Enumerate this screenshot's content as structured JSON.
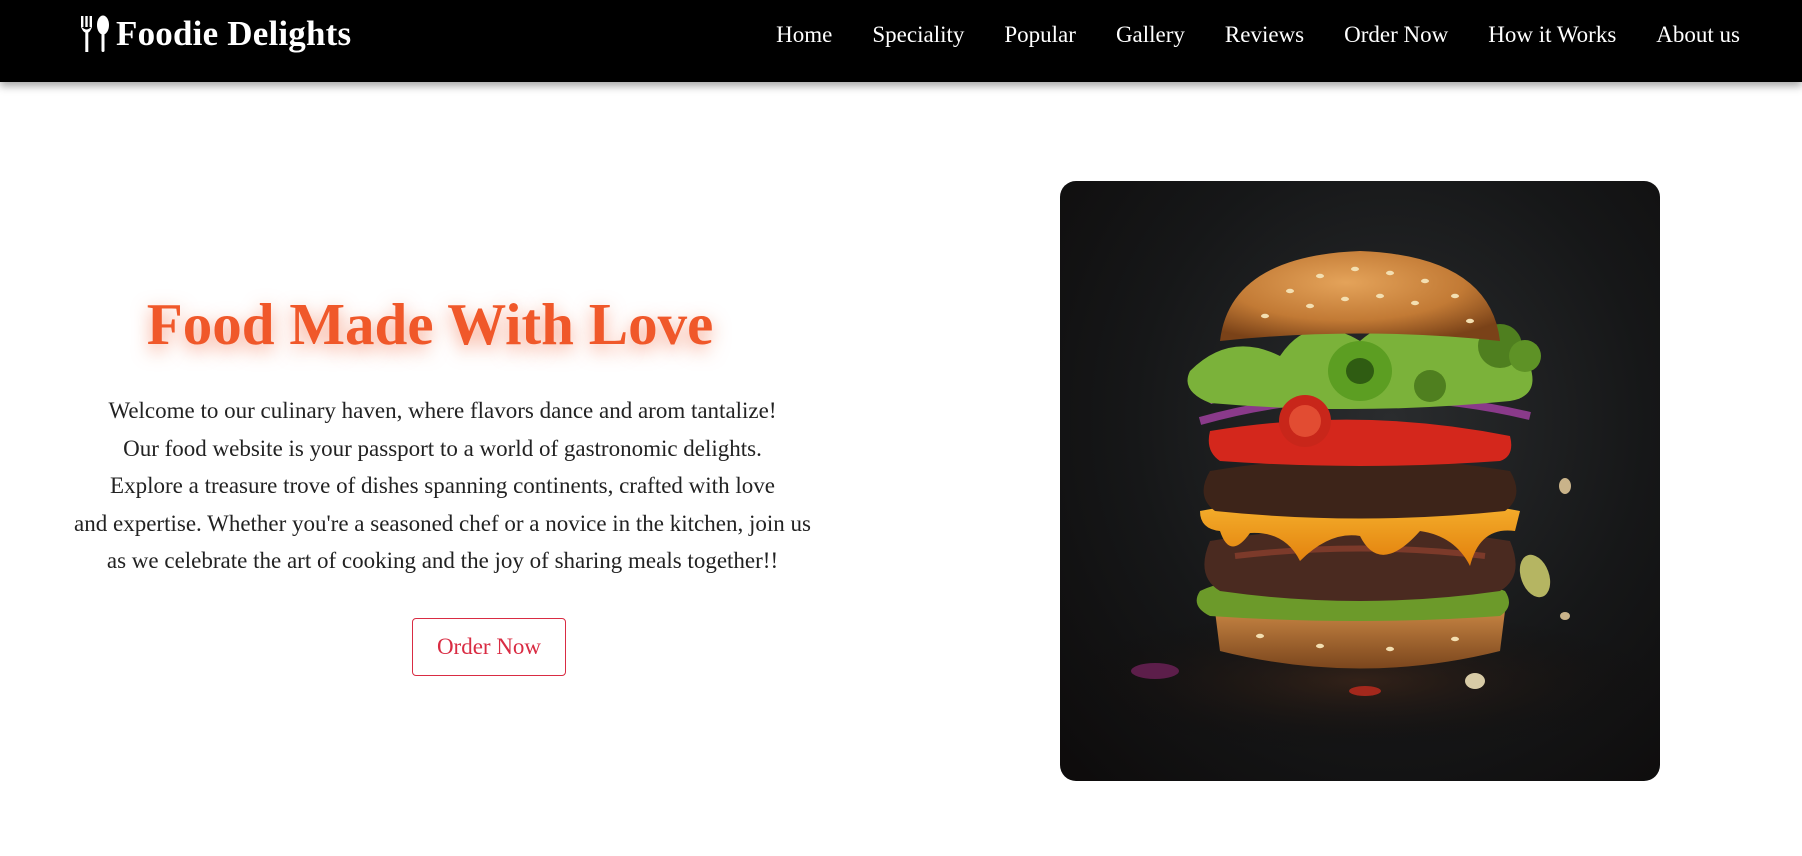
{
  "navbar": {
    "brand_icon": "fork-spoon-icon",
    "brand_name": "Foodie Delights",
    "links": [
      {
        "label": "Home"
      },
      {
        "label": "Speciality"
      },
      {
        "label": "Popular"
      },
      {
        "label": "Gallery"
      },
      {
        "label": "Reviews"
      },
      {
        "label": "Order Now"
      },
      {
        "label": "How it Works"
      },
      {
        "label": "About us"
      }
    ]
  },
  "hero": {
    "title": "Food Made With Love",
    "description_lines": [
      "Welcome to our culinary haven, where flavors dance and arom tantalize!",
      "Our food website is your passport to a world of gastronomic delights.",
      "Explore a treasure trove of dishes spanning continents, crafted with love",
      "and expertise. Whether you're a seasoned chef or a novice in the kitchen, join us",
      "as we celebrate the art of cooking and the joy of sharing meals together!!"
    ],
    "order_button_label": "Order Now",
    "image": "burger-image"
  },
  "colors": {
    "navbar_bg": "#000000",
    "title": "#f0582a",
    "button_accent": "#d92c43",
    "text": "#222222"
  }
}
